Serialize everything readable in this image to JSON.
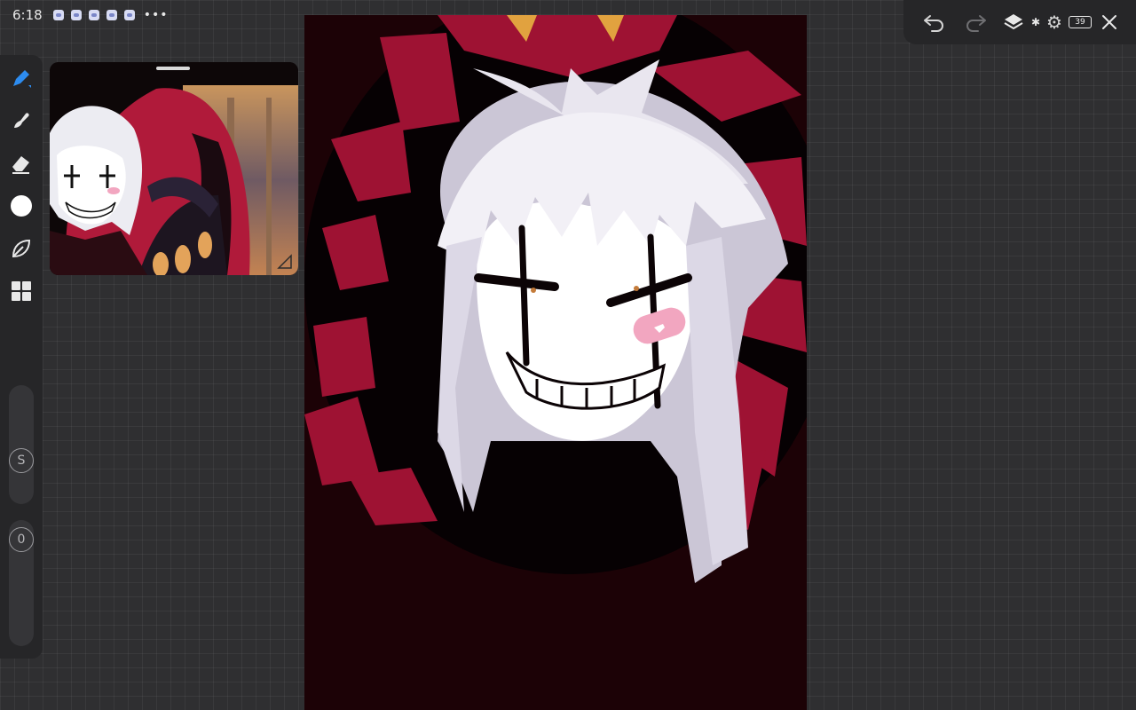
{
  "status_bar": {
    "time": "6:18",
    "notification_icons": [
      "app-notification-icon",
      "app-notification-icon",
      "app-notification-icon",
      "app-notification-icon",
      "app-notification-icon"
    ],
    "more": "•••"
  },
  "top_toolbar": {
    "undo_icon": "undo-icon",
    "redo_icon": "redo-icon",
    "layers_icon": "layers-icon",
    "bluetooth_icon": "bluetooth-icon",
    "settings_icon": "gear-icon",
    "battery_level": "39",
    "close_icon": "close-icon"
  },
  "sidebar": {
    "tools": [
      "brush-icon",
      "smudge-icon",
      "eraser-icon",
      "color-icon",
      "layers-leaf-icon",
      "grid-icon"
    ],
    "active_tool": "brush",
    "color": "#ffffff",
    "size_label": "S",
    "opacity_label": "0"
  },
  "colors": {
    "accent": "#2d8cf0",
    "panel": "#262628",
    "canvas_background": "#1c0206",
    "crimson": "#9e1233"
  }
}
